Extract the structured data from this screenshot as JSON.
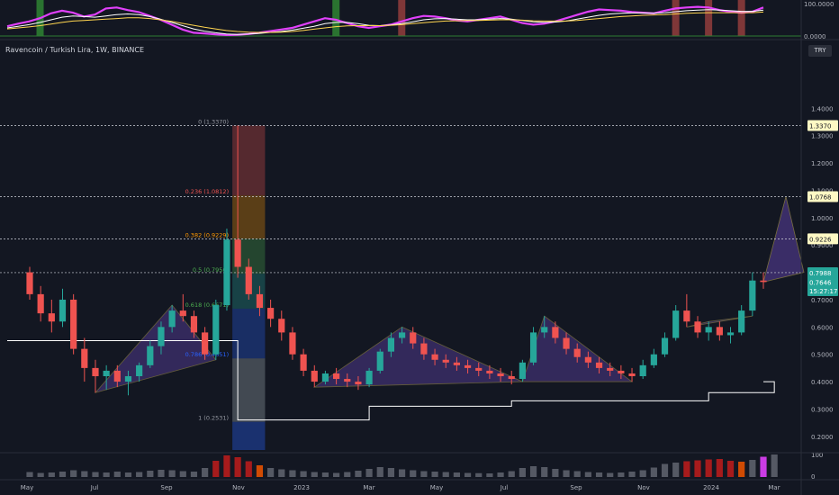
{
  "header": {
    "symbol_title": "Ravencoin / Turkish Lira, 1W, BINANCE"
  },
  "currency_badge": "TRY",
  "colors": {
    "background": "#131722",
    "bull": "#26a69a",
    "bear": "#ef5350",
    "oscillator": "#e040fb",
    "pattern_fill": "#5b3fa0",
    "fib_level": "#787b86",
    "trail_stop": "#ffffff"
  },
  "chart_data": [
    {
      "type": "line",
      "panel": "oscillator",
      "ylim": [
        0,
        100
      ],
      "yticks": [
        "100.0000",
        "0.0000"
      ],
      "series": [
        {
          "values": [
            30,
            38,
            45,
            55,
            70,
            78,
            72,
            60,
            66,
            85,
            88,
            80,
            74,
            62,
            50,
            35,
            20,
            10,
            8,
            5,
            3,
            4,
            6,
            10,
            15,
            20,
            25,
            35,
            45,
            55,
            50,
            40,
            30,
            25,
            30,
            35,
            45,
            55,
            62,
            60,
            55,
            48,
            45,
            50,
            55,
            60,
            50,
            40,
            35,
            38,
            45,
            55,
            65,
            75,
            82,
            80,
            78,
            74,
            72,
            70,
            78,
            85,
            88,
            90,
            88,
            80,
            75,
            72,
            75,
            88
          ]
        },
        {
          "values": [
            25,
            30,
            35,
            42,
            50,
            58,
            62,
            60,
            58,
            62,
            66,
            68,
            66,
            60,
            52,
            42,
            32,
            22,
            15,
            10,
            6,
            5,
            6,
            8,
            11,
            14,
            18,
            24,
            30,
            38,
            42,
            42,
            38,
            33,
            32,
            34,
            38,
            44,
            50,
            53,
            54,
            52,
            50,
            50,
            52,
            54,
            52,
            48,
            44,
            42,
            43,
            46,
            52,
            58,
            64,
            68,
            70,
            71,
            71,
            70,
            72,
            75,
            78,
            80,
            81,
            80,
            78,
            76,
            76,
            80
          ]
        },
        {
          "values": [
            22,
            25,
            28,
            32,
            37,
            42,
            46,
            48,
            50,
            52,
            54,
            56,
            56,
            54,
            50,
            45,
            39,
            33,
            27,
            22,
            17,
            14,
            12,
            11,
            11,
            12,
            14,
            17,
            21,
            25,
            29,
            31,
            32,
            32,
            32,
            33,
            35,
            38,
            41,
            44,
            46,
            47,
            48,
            48,
            49,
            50,
            50,
            49,
            47,
            46,
            46,
            46,
            48,
            51,
            54,
            57,
            60,
            62,
            64,
            65,
            66,
            68,
            70,
            71,
            72,
            72,
            72,
            72,
            72,
            74
          ]
        }
      ],
      "highlight_bars": [
        {
          "color": "green",
          "index": 3
        },
        {
          "color": "green",
          "index": 30
        },
        {
          "color": "red",
          "index": 36
        },
        {
          "color": "red",
          "index": 61
        },
        {
          "color": "red",
          "index": 64
        },
        {
          "color": "red",
          "index": 67
        }
      ]
    },
    {
      "type": "candlestick",
      "panel": "price",
      "ylim": [
        0.15,
        1.5
      ],
      "yticks": [
        "1.4000",
        "1.3000",
        "1.2000",
        "1.1000",
        "1.0000",
        "0.9000",
        "0.8000",
        "0.7000",
        "0.6000",
        "0.5000",
        "0.4000",
        "0.3000",
        "0.2000"
      ],
      "xticks": [
        "May",
        "Jul",
        "Sep",
        "Nov",
        "2023",
        "Mar",
        "May",
        "Jul",
        "Sep",
        "Nov",
        "2024",
        "Mar"
      ],
      "price_labels": [
        {
          "text": "1.3370",
          "value": 1.337
        },
        {
          "text": "1.0768",
          "value": 1.0768
        },
        {
          "text": "0.9226",
          "value": 0.9226
        },
        {
          "text": "0.7988",
          "value": 0.7988
        },
        {
          "text": "0.7646",
          "value": 0.7646
        },
        {
          "text": "15:27:17",
          "value": 0.733
        }
      ],
      "fib_labels": [
        {
          "text": "0 (1.3370)",
          "value": 1.337,
          "color": "#9598a1"
        },
        {
          "text": "0.236 (1.0812)",
          "value": 1.0812,
          "color": "#ef5350"
        },
        {
          "text": "0.382 (0.9229)",
          "value": 0.9229,
          "color": "#ff9800"
        },
        {
          "text": "0.5 (0.7950)",
          "value": 0.795,
          "color": "#4caf50"
        },
        {
          "text": "0.618 (0.6671)",
          "value": 0.6671,
          "color": "#4caf50"
        },
        {
          "text": "0.786 (0.4851)",
          "value": 0.4851,
          "color": "#2962ff"
        },
        {
          "text": "1 (0.2531)",
          "value": 0.2531,
          "color": "#9598a1"
        }
      ],
      "candles": [
        [
          0.8,
          0.82,
          0.7,
          0.72
        ],
        [
          0.72,
          0.75,
          0.62,
          0.65
        ],
        [
          0.65,
          0.7,
          0.58,
          0.62
        ],
        [
          0.62,
          0.74,
          0.6,
          0.7
        ],
        [
          0.7,
          0.72,
          0.5,
          0.52
        ],
        [
          0.52,
          0.56,
          0.4,
          0.45
        ],
        [
          0.45,
          0.48,
          0.36,
          0.42
        ],
        [
          0.42,
          0.46,
          0.37,
          0.44
        ],
        [
          0.44,
          0.46,
          0.38,
          0.4
        ],
        [
          0.4,
          0.44,
          0.35,
          0.42
        ],
        [
          0.42,
          0.47,
          0.4,
          0.46
        ],
        [
          0.46,
          0.55,
          0.45,
          0.53
        ],
        [
          0.53,
          0.62,
          0.5,
          0.6
        ],
        [
          0.6,
          0.68,
          0.58,
          0.66
        ],
        [
          0.66,
          0.72,
          0.62,
          0.64
        ],
        [
          0.64,
          0.66,
          0.56,
          0.58
        ],
        [
          0.58,
          0.6,
          0.48,
          0.5
        ],
        [
          0.5,
          0.7,
          0.48,
          0.68
        ],
        [
          0.68,
          0.96,
          0.66,
          0.92
        ],
        [
          0.92,
          1.337,
          0.78,
          0.82
        ],
        [
          0.82,
          0.85,
          0.7,
          0.72
        ],
        [
          0.72,
          0.75,
          0.64,
          0.67
        ],
        [
          0.67,
          0.7,
          0.6,
          0.63
        ],
        [
          0.63,
          0.66,
          0.55,
          0.58
        ],
        [
          0.58,
          0.6,
          0.48,
          0.5
        ],
        [
          0.5,
          0.52,
          0.42,
          0.44
        ],
        [
          0.44,
          0.46,
          0.38,
          0.4
        ],
        [
          0.4,
          0.44,
          0.39,
          0.43
        ],
        [
          0.43,
          0.45,
          0.39,
          0.41
        ],
        [
          0.41,
          0.43,
          0.38,
          0.4
        ],
        [
          0.4,
          0.42,
          0.37,
          0.39
        ],
        [
          0.39,
          0.45,
          0.38,
          0.44
        ],
        [
          0.44,
          0.52,
          0.43,
          0.51
        ],
        [
          0.51,
          0.58,
          0.49,
          0.56
        ],
        [
          0.56,
          0.6,
          0.54,
          0.58
        ],
        [
          0.58,
          0.6,
          0.52,
          0.54
        ],
        [
          0.54,
          0.56,
          0.48,
          0.5
        ],
        [
          0.5,
          0.52,
          0.46,
          0.48
        ],
        [
          0.48,
          0.5,
          0.45,
          0.47
        ],
        [
          0.47,
          0.49,
          0.44,
          0.46
        ],
        [
          0.46,
          0.48,
          0.43,
          0.45
        ],
        [
          0.45,
          0.47,
          0.42,
          0.44
        ],
        [
          0.44,
          0.46,
          0.41,
          0.43
        ],
        [
          0.43,
          0.45,
          0.4,
          0.42
        ],
        [
          0.42,
          0.44,
          0.39,
          0.41
        ],
        [
          0.41,
          0.48,
          0.4,
          0.47
        ],
        [
          0.47,
          0.6,
          0.46,
          0.58
        ],
        [
          0.58,
          0.64,
          0.56,
          0.6
        ],
        [
          0.6,
          0.62,
          0.54,
          0.56
        ],
        [
          0.56,
          0.58,
          0.5,
          0.52
        ],
        [
          0.52,
          0.54,
          0.47,
          0.49
        ],
        [
          0.49,
          0.51,
          0.45,
          0.47
        ],
        [
          0.47,
          0.49,
          0.43,
          0.45
        ],
        [
          0.45,
          0.47,
          0.42,
          0.44
        ],
        [
          0.44,
          0.46,
          0.41,
          0.43
        ],
        [
          0.43,
          0.45,
          0.4,
          0.42
        ],
        [
          0.42,
          0.48,
          0.41,
          0.46
        ],
        [
          0.46,
          0.52,
          0.45,
          0.5
        ],
        [
          0.5,
          0.58,
          0.49,
          0.56
        ],
        [
          0.56,
          0.68,
          0.55,
          0.66
        ],
        [
          0.66,
          0.72,
          0.6,
          0.62
        ],
        [
          0.62,
          0.64,
          0.56,
          0.58
        ],
        [
          0.58,
          0.62,
          0.55,
          0.6
        ],
        [
          0.6,
          0.62,
          0.55,
          0.57
        ],
        [
          0.57,
          0.6,
          0.54,
          0.58
        ],
        [
          0.58,
          0.68,
          0.57,
          0.66
        ],
        [
          0.66,
          0.8,
          0.64,
          0.77
        ],
        [
          0.77,
          0.8,
          0.74,
          0.7646
        ]
      ],
      "volume": [
        22,
        18,
        20,
        24,
        30,
        26,
        22,
        20,
        24,
        20,
        22,
        28,
        32,
        30,
        26,
        24,
        40,
        72,
        96,
        88,
        70,
        52,
        40,
        34,
        30,
        26,
        22,
        20,
        18,
        22,
        28,
        36,
        44,
        40,
        34,
        30,
        26,
        24,
        22,
        20,
        18,
        17,
        16,
        20,
        26,
        40,
        48,
        44,
        36,
        30,
        26,
        22,
        20,
        18,
        20,
        24,
        30,
        42,
        58,
        64,
        70,
        74,
        78,
        80,
        72,
        68,
        76,
        90,
        100
      ]
    }
  ]
}
